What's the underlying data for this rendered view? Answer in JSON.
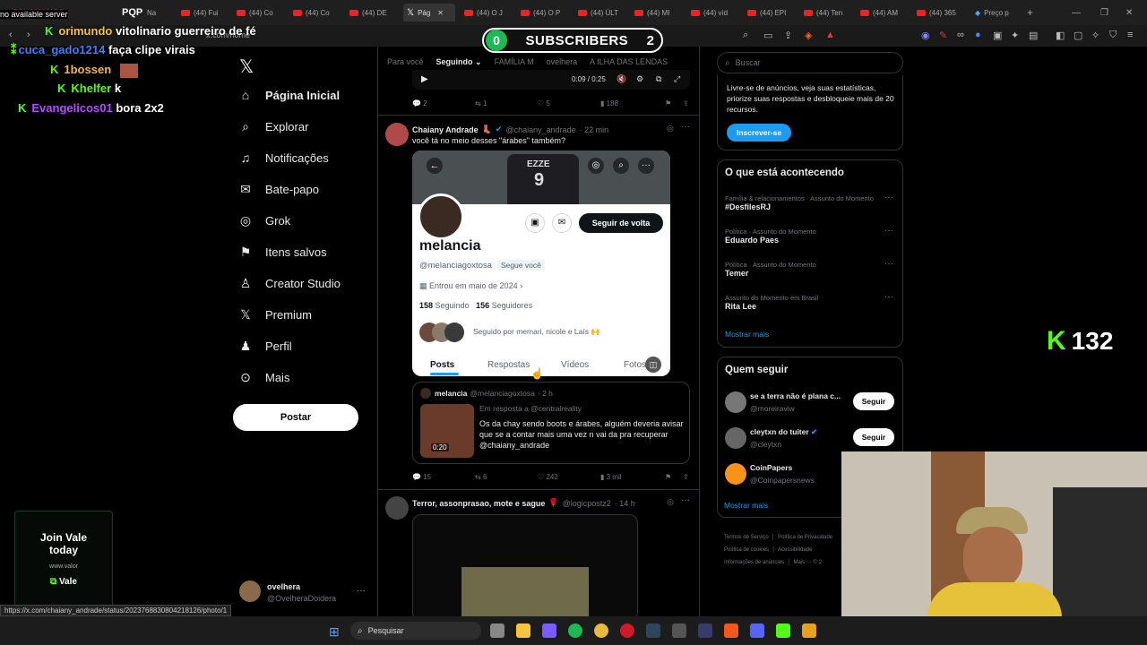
{
  "browser": {
    "tabs": [
      {
        "label": "PQP"
      },
      {
        "label": "Na"
      },
      {
        "label": "(44) Fui"
      },
      {
        "label": "(44) Co"
      },
      {
        "label": "(44) Co"
      },
      {
        "label": "(44) DE"
      },
      {
        "label": "Pág"
      },
      {
        "label": "(44) O J"
      },
      {
        "label": "(44) O P"
      },
      {
        "label": "(44) ÚLT"
      },
      {
        "label": "(44) MI"
      },
      {
        "label": "(44) víd"
      },
      {
        "label": "(44) EPI"
      },
      {
        "label": "(44) Ten"
      },
      {
        "label": "(44) AM"
      },
      {
        "label": "(44) 365"
      },
      {
        "label": "Preço p"
      }
    ],
    "url": "x.com/home",
    "status_url": "https://x.com/chaiany_andrade/status/2023768830804218126/photo/1",
    "no_server": "no available server"
  },
  "chat": [
    {
      "user": "orimundo",
      "msg": "vitolinario guerreiro de fé",
      "color": "#f5c542"
    },
    {
      "user": "cuca_gado1214",
      "msg": "faça clipe virais",
      "color": "#3d7fff"
    },
    {
      "user": "1bossen",
      "msg": "",
      "color": "#f5b342"
    },
    {
      "user": "Khelfer",
      "msg": "k",
      "color": "#53fc18"
    },
    {
      "user": "Evangelicos01",
      "msg": "bora 2x2",
      "color": "#b44cff"
    }
  ],
  "subscribers": {
    "left": "0",
    "label": "SUBSCRIBERS",
    "right": "2"
  },
  "kick_count": "132",
  "join": {
    "line1": "Join Vale",
    "line2": "today",
    "site": "www.valor",
    "brand": "Vale"
  },
  "nav": {
    "items": [
      {
        "label": "Página Inicial"
      },
      {
        "label": "Explorar"
      },
      {
        "label": "Notificações"
      },
      {
        "label": "Bate-papo"
      },
      {
        "label": "Grok"
      },
      {
        "label": "Itens salvos"
      },
      {
        "label": "Creator Studio"
      },
      {
        "label": "Premium"
      },
      {
        "label": "Perfil"
      },
      {
        "label": "Mais"
      }
    ],
    "post_label": "Postar",
    "account_name": "ovelhera",
    "account_handle": "@OvelheraDoidera"
  },
  "feed": {
    "tabs": [
      "Para você",
      "Seguindo",
      "FAMÍLIA M",
      "ovelhera",
      "A ILHA DAS LENDAS"
    ],
    "video_time": "0:09 / 0:25",
    "prev_stats": {
      "replies": "2",
      "reposts": "1",
      "likes": "5",
      "views": "188"
    },
    "post": {
      "name": "Chaiany Andrade",
      "handle": "@chaiany_andrade",
      "time": "22 min",
      "text": "você tá no meio desses \"árabes\" também?",
      "stats": {
        "replies": "15",
        "reposts": "6",
        "likes": "242",
        "views": "3 mil"
      }
    },
    "profile": {
      "name": "melancia",
      "handle": "@melanciagoxtosa",
      "follows_you": "Segue você",
      "joined": "Entrou em maio de 2024",
      "following_count": "158",
      "following_label": "Seguindo",
      "followers_count": "156",
      "followers_label": "Seguidores",
      "followed_by": "Seguido por memari, nicole e Laís 🙌",
      "follow_back": "Seguir de volta",
      "tabs": [
        "Posts",
        "Respostas",
        "Vídeos",
        "Fotos"
      ],
      "jersey": "EZZE"
    },
    "quote": {
      "name": "melancia",
      "handle": "@melanciagoxtosa",
      "time": "2 h",
      "reply_to": "Em resposta a @centralreality",
      "text": "Os da chay sendo boots e árabes, alguém deveria avisar que se a contar mais uma vez n vai da pra recuperar @chaiany_andrade",
      "duration": "0:20"
    },
    "post2": {
      "name": "Terror, assonprasao, mote e sague",
      "handle": "@logicpostz2",
      "time": "14 h"
    }
  },
  "right": {
    "search_placeholder": "Buscar",
    "premium_text": "Livre-se de anúncios, veja suas estatísticas, priorize suas respostas e desbloqueie mais de 20 recursos.",
    "subscribe": "Inscrever-se",
    "trends_title": "O que está acontecendo",
    "trends": [
      {
        "cat": "Família & relacionamentos · Assunto do Momento",
        "name": "#DesfilesRJ"
      },
      {
        "cat": "Política · Assunto do Momento",
        "name": "Eduardo Paes"
      },
      {
        "cat": "Política · Assunto do Momento",
        "name": "Temer"
      },
      {
        "cat": "Assunto do Momento em Brasil",
        "name": "Rita Lee"
      }
    ],
    "show_more": "Mostrar mais",
    "who_title": "Quem seguir",
    "who": [
      {
        "name": "se a terra não é plana c...",
        "handle": "@moreiraviw",
        "btn": "Seguir"
      },
      {
        "name": "cleytxn do tuiter",
        "handle": "@cleytxn",
        "btn": "Seguir"
      },
      {
        "name": "CoinPapers",
        "handle": "@Coinpapersnews",
        "btn": ""
      }
    ],
    "show_more2": "Mostrar mais",
    "footer": [
      "Termos de Serviço",
      "Política de Privacidade",
      "Política de cookies",
      "Acessibilidade",
      "Informações de anúncios",
      "Mais ···",
      "© 2"
    ]
  },
  "taskbar": {
    "search": "Pesquisar"
  }
}
